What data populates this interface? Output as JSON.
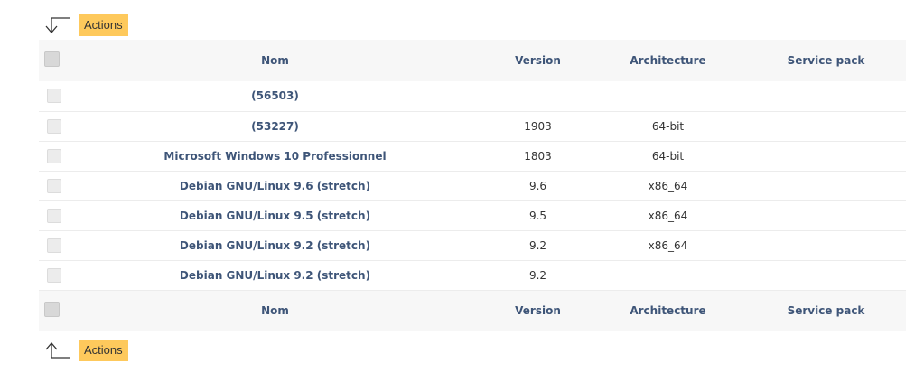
{
  "actions": {
    "label": "Actions"
  },
  "columns": {
    "name": "Nom",
    "version": "Version",
    "architecture": "Architecture",
    "service_pack": "Service pack"
  },
  "rows": [
    {
      "name": "(56503)",
      "version": "",
      "architecture": "",
      "service_pack": ""
    },
    {
      "name": "(53227)",
      "version": "1903",
      "architecture": "64-bit",
      "service_pack": ""
    },
    {
      "name": "Microsoft Windows 10 Professionnel",
      "version": "1803",
      "architecture": "64-bit",
      "service_pack": ""
    },
    {
      "name": "Debian GNU/Linux 9.6 (stretch)",
      "version": "9.6",
      "architecture": "x86_64",
      "service_pack": ""
    },
    {
      "name": "Debian GNU/Linux 9.5 (stretch)",
      "version": "9.5",
      "architecture": "x86_64",
      "service_pack": ""
    },
    {
      "name": "Debian GNU/Linux 9.2 (stretch)",
      "version": "9.2",
      "architecture": "x86_64",
      "service_pack": ""
    },
    {
      "name": "Debian GNU/Linux 9.2 (stretch)",
      "version": "9.2",
      "architecture": "",
      "service_pack": ""
    }
  ],
  "colors": {
    "accent": "#fec95c",
    "link": "#3e5578",
    "header_bg": "#f7f7f7"
  },
  "icons": {
    "top_arrow": "arrow-down-left-icon",
    "bottom_arrow": "arrow-up-left-icon"
  }
}
